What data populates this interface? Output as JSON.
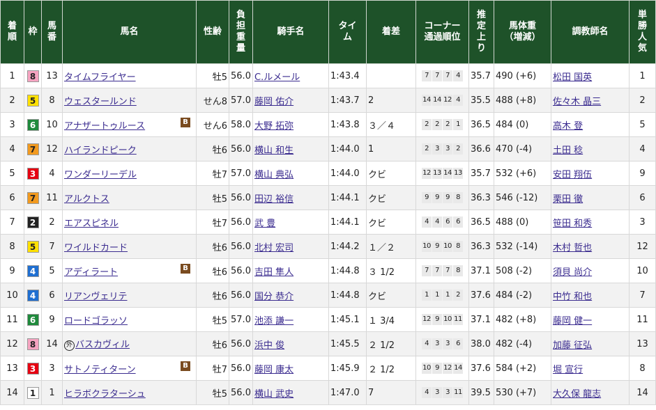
{
  "headers": [
    "着順",
    "枠",
    "馬番",
    "馬名",
    "性齢",
    "負担重量",
    "騎手名",
    "タイム",
    "着差",
    "コーナー通過順位",
    "推定上り",
    "馬体重（増減）",
    "調教師名",
    "単勝人気"
  ],
  "header_lines": {
    "place": [
      "着",
      "順"
    ],
    "waku": [
      "枠"
    ],
    "umaban": [
      "馬",
      "番"
    ],
    "weight": [
      "負",
      "担",
      "重",
      "量"
    ],
    "time": [
      "タイ",
      "ム"
    ],
    "corner": [
      "コーナー",
      "通過順位"
    ],
    "agari": [
      "推",
      "定",
      "上",
      "り"
    ],
    "body": [
      "馬体重",
      "（増減）"
    ],
    "pop": [
      "単",
      "勝",
      "人",
      "気"
    ]
  },
  "blinker_label": "B",
  "foreign_label": "外",
  "waku_colors": {
    "1": {
      "bg": "#ffffff",
      "fg": "#222222"
    },
    "2": {
      "bg": "#222222",
      "fg": "#ffffff"
    },
    "3": {
      "bg": "#e60012",
      "fg": "#ffffff"
    },
    "4": {
      "bg": "#1f6fd1",
      "fg": "#ffffff"
    },
    "5": {
      "bg": "#ffe000",
      "fg": "#222222"
    },
    "6": {
      "bg": "#1f8a3c",
      "fg": "#ffffff"
    },
    "7": {
      "bg": "#f29a1f",
      "fg": "#222222"
    },
    "8": {
      "bg": "#f5a3c0",
      "fg": "#222222"
    }
  },
  "rows": [
    {
      "place": "1",
      "waku": "8",
      "umaban": "13",
      "horse": "タイムフライヤー",
      "blinker": false,
      "foreign": false,
      "sexage": "牡5",
      "weight": "56.0",
      "jockey": "C.ルメール",
      "time": "1:43.4",
      "margin": "",
      "corners": [
        "7",
        "7",
        "7",
        "4"
      ],
      "agari": "35.7",
      "body": "490 (+6)",
      "trainer": "松田 国英",
      "pop": "1"
    },
    {
      "place": "2",
      "waku": "5",
      "umaban": "8",
      "horse": "ウェスタールンド",
      "blinker": false,
      "foreign": false,
      "sexage": "せん8",
      "weight": "57.0",
      "jockey": "藤岡 佑介",
      "time": "1:43.7",
      "margin": "2",
      "corners": [
        "14",
        "14",
        "12",
        "4"
      ],
      "agari": "35.5",
      "body": "488 (+8)",
      "trainer": "佐々木 晶三",
      "pop": "2"
    },
    {
      "place": "3",
      "waku": "6",
      "umaban": "10",
      "horse": "アナザートゥルース",
      "blinker": true,
      "foreign": false,
      "sexage": "せん6",
      "weight": "58.0",
      "jockey": "大野 拓弥",
      "time": "1:43.8",
      "margin": "３／４",
      "corners": [
        "2",
        "2",
        "2",
        "1"
      ],
      "agari": "36.5",
      "body": "484 (0)",
      "trainer": "高木 登",
      "pop": "5"
    },
    {
      "place": "4",
      "waku": "7",
      "umaban": "12",
      "horse": "ハイランドピーク",
      "blinker": false,
      "foreign": false,
      "sexage": "牡6",
      "weight": "56.0",
      "jockey": "横山 和生",
      "time": "1:44.0",
      "margin": "1",
      "corners": [
        "2",
        "3",
        "3",
        "2"
      ],
      "agari": "36.6",
      "body": "470 (-4)",
      "trainer": "土田 稔",
      "pop": "4"
    },
    {
      "place": "5",
      "waku": "3",
      "umaban": "4",
      "horse": "ワンダーリーデル",
      "blinker": false,
      "foreign": false,
      "sexage": "牡7",
      "weight": "57.0",
      "jockey": "横山 典弘",
      "time": "1:44.0",
      "margin": "クビ",
      "corners": [
        "12",
        "13",
        "14",
        "13"
      ],
      "agari": "35.7",
      "body": "532 (+6)",
      "trainer": "安田 翔伍",
      "pop": "9"
    },
    {
      "place": "6",
      "waku": "7",
      "umaban": "11",
      "horse": "アルクトス",
      "blinker": false,
      "foreign": false,
      "sexage": "牡5",
      "weight": "56.0",
      "jockey": "田辺 裕信",
      "time": "1:44.1",
      "margin": "クビ",
      "corners": [
        "9",
        "9",
        "9",
        "8"
      ],
      "agari": "36.3",
      "body": "546 (-12)",
      "trainer": "栗田 徹",
      "pop": "6"
    },
    {
      "place": "7",
      "waku": "2",
      "umaban": "2",
      "horse": "エアスピネル",
      "blinker": false,
      "foreign": false,
      "sexage": "牡7",
      "weight": "56.0",
      "jockey": "武 豊",
      "time": "1:44.1",
      "margin": "クビ",
      "corners": [
        "4",
        "4",
        "6",
        "6"
      ],
      "agari": "36.5",
      "body": "488 (0)",
      "trainer": "笹田 和秀",
      "pop": "3"
    },
    {
      "place": "8",
      "waku": "5",
      "umaban": "7",
      "horse": "ワイルドカード",
      "blinker": false,
      "foreign": false,
      "sexage": "牡6",
      "weight": "56.0",
      "jockey": "北村 宏司",
      "time": "1:44.2",
      "margin": "１／２",
      "corners": [
        "10",
        "9",
        "10",
        "8"
      ],
      "agari": "36.3",
      "body": "532 (-14)",
      "trainer": "木村 哲也",
      "pop": "12"
    },
    {
      "place": "9",
      "waku": "4",
      "umaban": "5",
      "horse": "アディラート",
      "blinker": true,
      "foreign": false,
      "sexage": "牡6",
      "weight": "56.0",
      "jockey": "吉田 隼人",
      "time": "1:44.8",
      "margin": "３ 1/2",
      "corners": [
        "7",
        "7",
        "7",
        "8"
      ],
      "agari": "37.1",
      "body": "508 (-2)",
      "trainer": "須貝 尚介",
      "pop": "10"
    },
    {
      "place": "10",
      "waku": "4",
      "umaban": "6",
      "horse": "リアンヴェリテ",
      "blinker": false,
      "foreign": false,
      "sexage": "牡6",
      "weight": "56.0",
      "jockey": "国分 恭介",
      "time": "1:44.8",
      "margin": "クビ",
      "corners": [
        "1",
        "1",
        "1",
        "2"
      ],
      "agari": "37.6",
      "body": "484 (-2)",
      "trainer": "中竹 和也",
      "pop": "7"
    },
    {
      "place": "11",
      "waku": "6",
      "umaban": "9",
      "horse": "ロードゴラッソ",
      "blinker": false,
      "foreign": false,
      "sexage": "牡5",
      "weight": "57.0",
      "jockey": "池添 謙一",
      "time": "1:45.1",
      "margin": "１ 3/4",
      "corners": [
        "12",
        "9",
        "10",
        "11"
      ],
      "agari": "37.1",
      "body": "482 (+8)",
      "trainer": "藤岡 健一",
      "pop": "11"
    },
    {
      "place": "12",
      "waku": "8",
      "umaban": "14",
      "horse": "バスカヴィル",
      "blinker": false,
      "foreign": true,
      "sexage": "牡6",
      "weight": "56.0",
      "jockey": "浜中 俊",
      "time": "1:45.5",
      "margin": "２ 1/2",
      "corners": [
        "4",
        "3",
        "3",
        "6"
      ],
      "agari": "38.0",
      "body": "482 (-4)",
      "trainer": "加藤 征弘",
      "pop": "13"
    },
    {
      "place": "13",
      "waku": "3",
      "umaban": "3",
      "horse": "サトノティターン",
      "blinker": true,
      "foreign": false,
      "sexage": "牡7",
      "weight": "56.0",
      "jockey": "藤岡 康太",
      "time": "1:45.9",
      "margin": "２ 1/2",
      "corners": [
        "10",
        "9",
        "12",
        "14"
      ],
      "agari": "37.6",
      "body": "584 (+2)",
      "trainer": "堀 宣行",
      "pop": "8"
    },
    {
      "place": "14",
      "waku": "1",
      "umaban": "1",
      "horse": "ヒラボクラターシュ",
      "blinker": false,
      "foreign": false,
      "sexage": "牡5",
      "weight": "56.0",
      "jockey": "横山 武史",
      "time": "1:47.0",
      "margin": "7",
      "corners": [
        "4",
        "3",
        "3",
        "11"
      ],
      "agari": "39.5",
      "body": "530 (+7)",
      "trainer": "大久保 龍志",
      "pop": "14"
    }
  ]
}
